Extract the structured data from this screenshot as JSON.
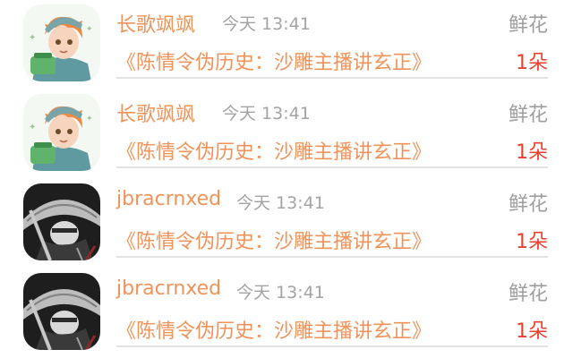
{
  "gifts": [
    {
      "sender": "长歌飒飒",
      "time": "今天 13:41",
      "gift_type": "鲜花",
      "book_title": "《陈情令伪历史：沙雕主播讲玄正》",
      "count": "1朵",
      "avatar_icon": "anime-boy-orange-hair-avatar-icon"
    },
    {
      "sender": "长歌飒飒",
      "time": "今天 13:41",
      "gift_type": "鲜花",
      "book_title": "《陈情令伪历史：沙雕主播讲玄正》",
      "count": "1朵",
      "avatar_icon": "anime-boy-orange-hair-avatar-icon"
    },
    {
      "sender": "jbracrnxed",
      "time": "今天 13:41",
      "gift_type": "鲜花",
      "book_title": "《陈情令伪历史：沙雕主播讲玄正》",
      "count": "1朵",
      "avatar_icon": "straw-hat-warrior-avatar-icon"
    },
    {
      "sender": "jbracrnxed",
      "time": "今天 13:41",
      "gift_type": "鲜花",
      "book_title": "《陈情令伪历史：沙雕主播讲玄正》",
      "count": "1朵",
      "avatar_icon": "straw-hat-warrior-avatar-icon"
    }
  ],
  "colors": {
    "name_orange": "#f0935a",
    "count_red": "#e8422f",
    "meta_gray": "#a3a3a3",
    "divider": "#e3e3e3"
  }
}
